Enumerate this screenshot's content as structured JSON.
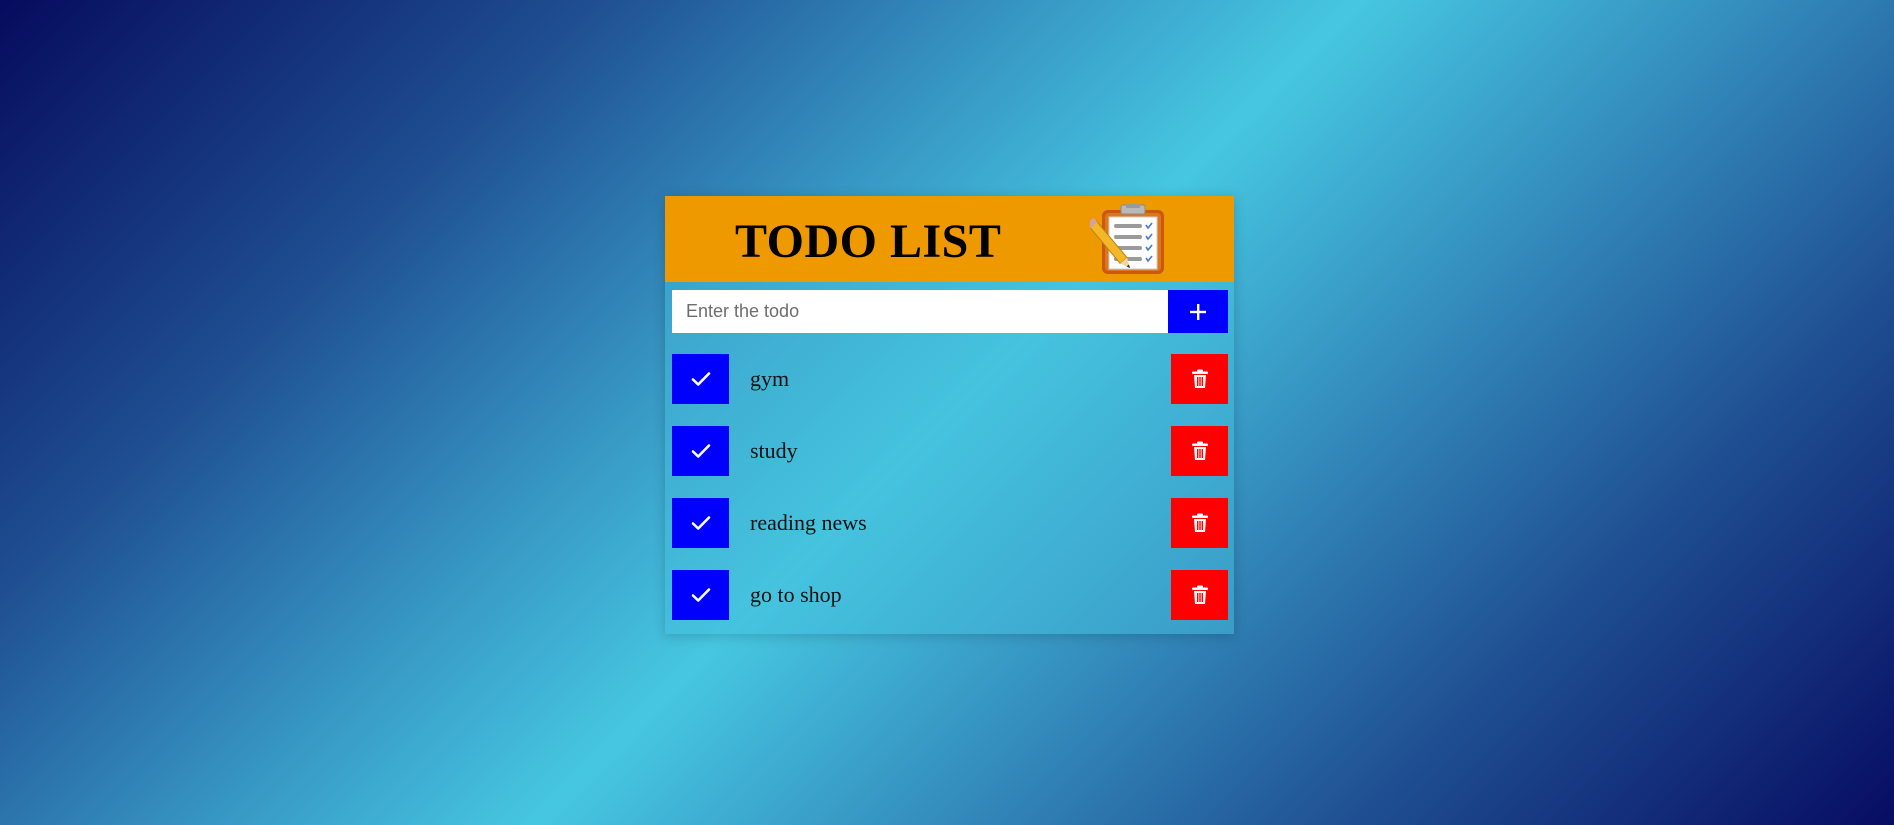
{
  "header": {
    "title": "TODO LIST",
    "icon": "clipboard-checklist-icon"
  },
  "input": {
    "value": "",
    "placeholder": "Enter the todo",
    "add_icon": "plus-icon"
  },
  "todos": [
    {
      "text": "gym",
      "check_icon": "check-icon",
      "delete_icon": "trash-icon"
    },
    {
      "text": "study",
      "check_icon": "check-icon",
      "delete_icon": "trash-icon"
    },
    {
      "text": "reading news",
      "check_icon": "check-icon",
      "delete_icon": "trash-icon"
    },
    {
      "text": "go to shop",
      "check_icon": "check-icon",
      "delete_icon": "trash-icon"
    }
  ],
  "colors": {
    "header_bg": "#ef9900",
    "check_button": "#0000ff",
    "add_button": "#0000ff",
    "delete_button": "#ff0000"
  }
}
